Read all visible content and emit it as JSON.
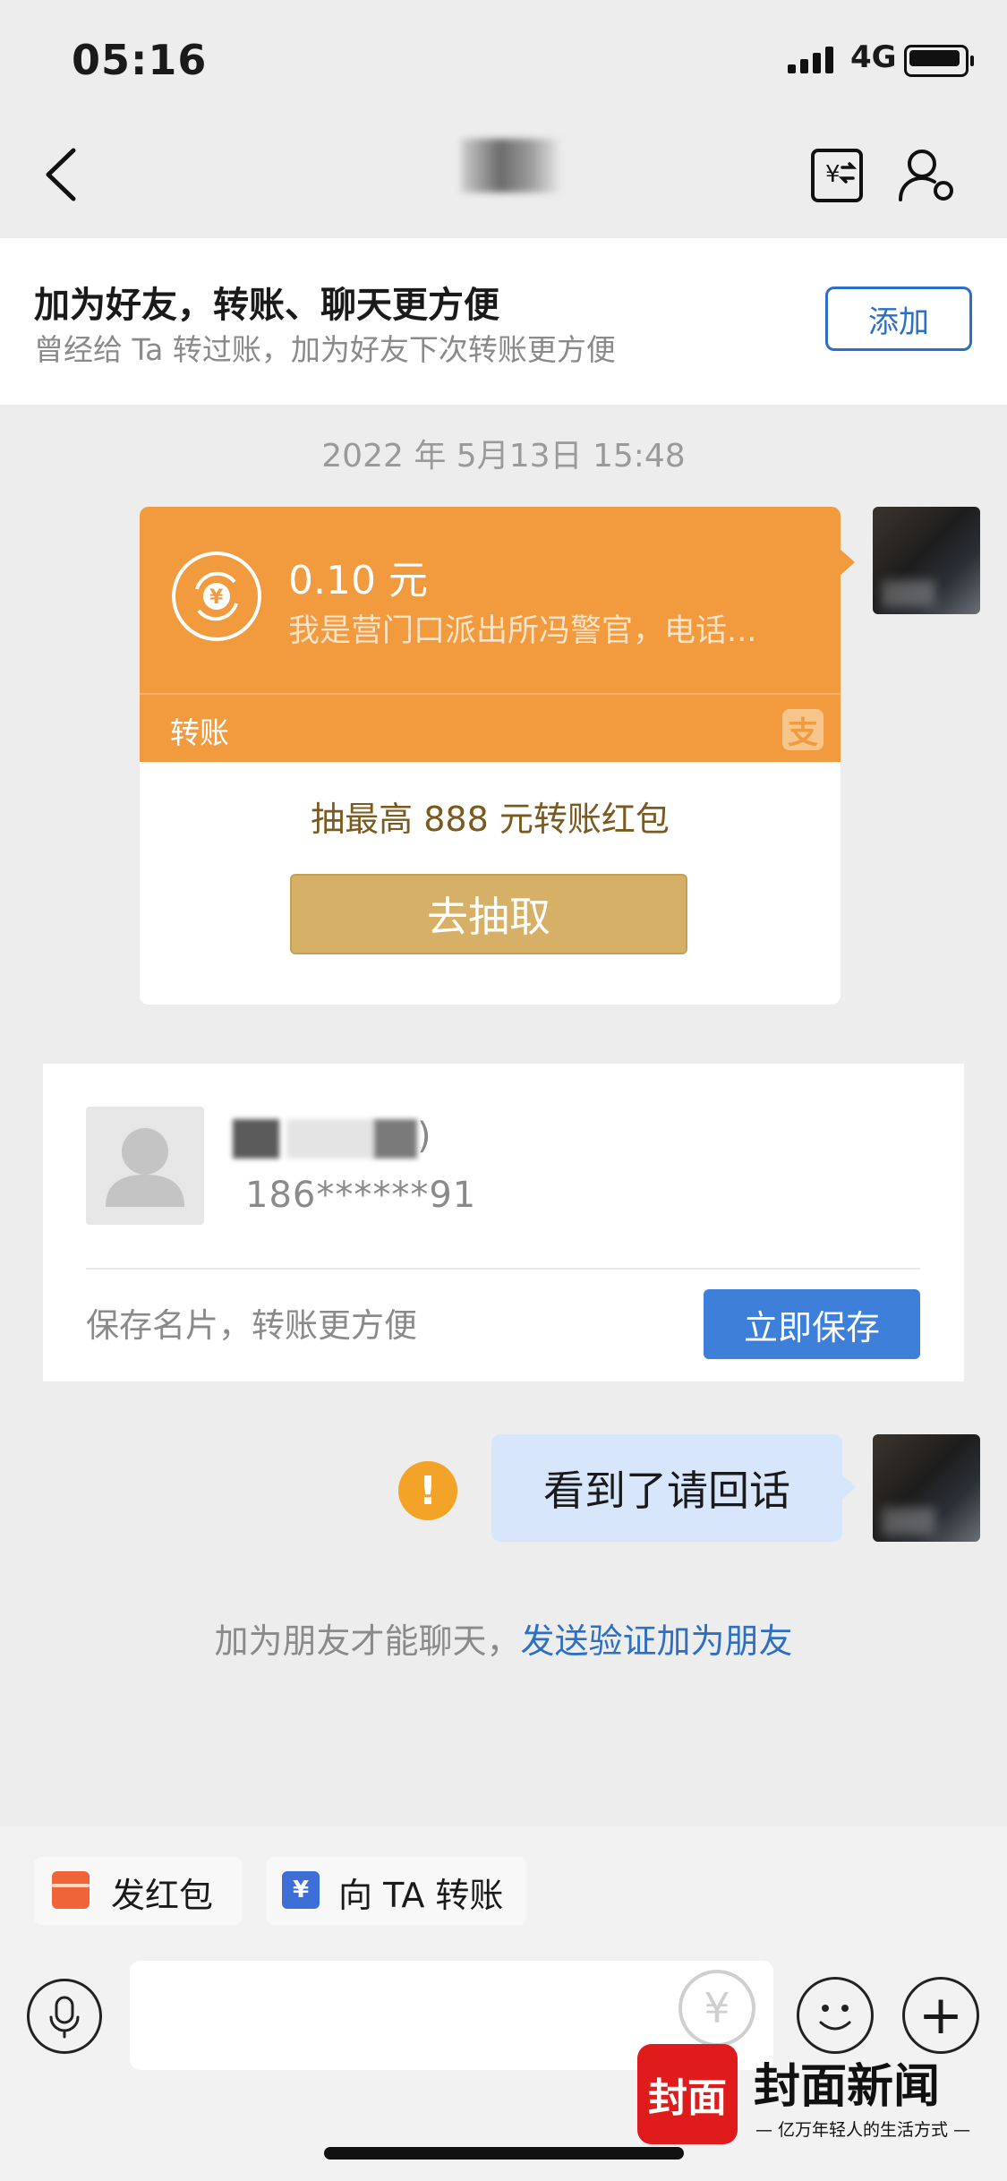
{
  "status_bar": {
    "time": "05:16",
    "network": "4G"
  },
  "nav": {
    "back_icon": "chevron-left-icon",
    "bill_icon": "yen-exchange-icon",
    "profile_icon": "user-settings-icon"
  },
  "banner": {
    "title": "加为好友，转账、聊天更方便",
    "subtitle": "曾经给 Ta 转过账，加为好友下次转账更方便",
    "add_label": "添加"
  },
  "timestamp": "2022 年 5月13日 15:48",
  "transfer_card": {
    "amount": "0.10 元",
    "note": "我是营门口派出所冯警官，电话...",
    "label": "转账",
    "brand_glyph": "支",
    "promo": "抽最高 888 元转账红包",
    "cta": "去抽取",
    "accent_color": "#f19a3e"
  },
  "contact_card": {
    "name_suffix": ")",
    "phone": "186******91",
    "hint": "保存名片，转账更方便",
    "save_label": "立即保存"
  },
  "message": {
    "text": "看到了请回话",
    "status_icon": "!"
  },
  "friend_tip": {
    "text": "加为朋友才能聊天，",
    "link": "发送验证加为朋友"
  },
  "quick_actions": [
    {
      "label": "发红包",
      "icon": "red-envelope-icon"
    },
    {
      "label": "向 TA 转账",
      "icon": "transfer-icon"
    }
  ],
  "input_bar": {
    "yen_glyph": "¥",
    "plus_glyph": "+"
  },
  "watermark": {
    "badge": "封面",
    "name": "封面新闻",
    "slogan": "— 亿万年轻人的生活方式 —"
  }
}
